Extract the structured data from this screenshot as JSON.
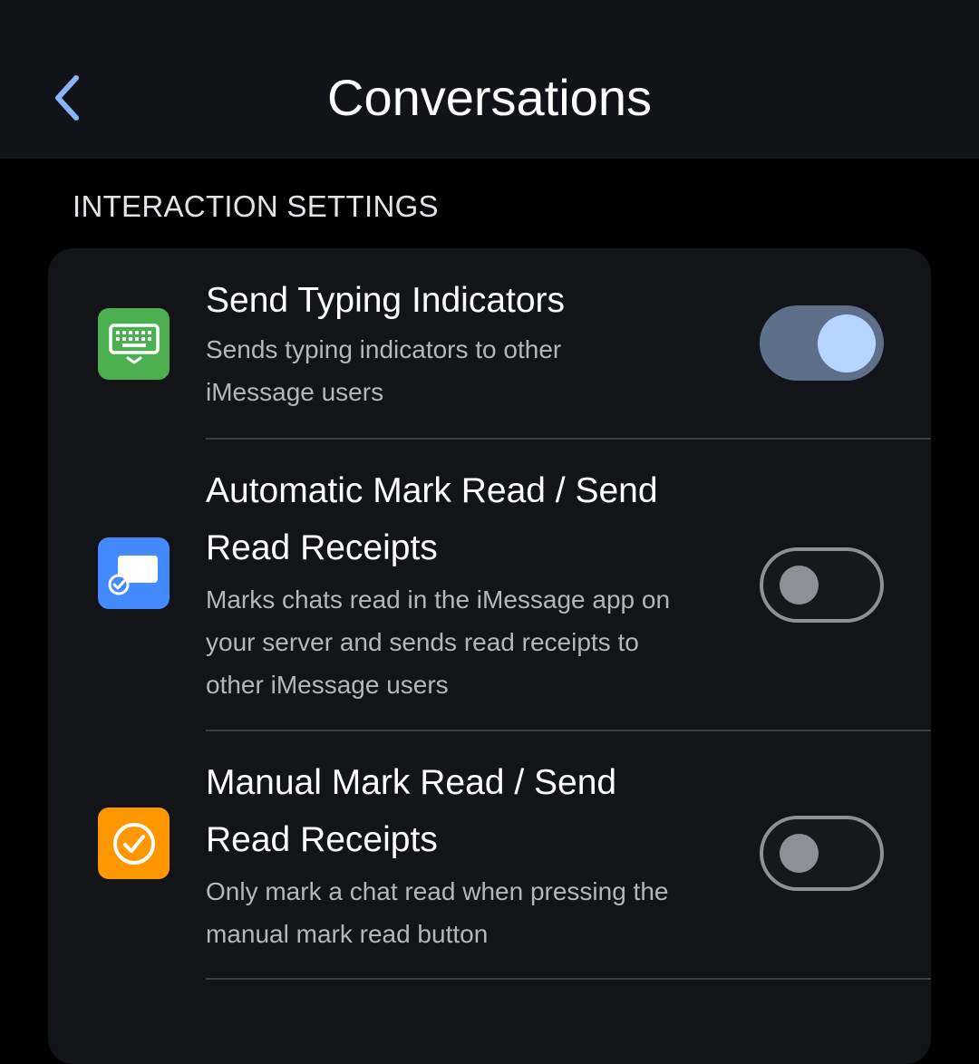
{
  "header": {
    "title": "Conversations",
    "back_icon": "chevron-left-icon",
    "accent_color": "#8ab4f8"
  },
  "section": {
    "title": "INTERACTION SETTINGS"
  },
  "settings": [
    {
      "title_lines": [
        "Send Typing Indicators"
      ],
      "subtitle_lines": [
        "Sends typing indicators to other",
        "iMessage users"
      ],
      "icon": "keyboard-icon",
      "icon_color": "#4caf50",
      "enabled": true
    },
    {
      "title_lines": [
        "Automatic Mark Read / Send",
        "Read Receipts"
      ],
      "subtitle_lines": [
        "Marks chats read in the iMessage app on",
        "your server and sends read receipts to",
        "other iMessage users"
      ],
      "icon": "mark-read-icon",
      "icon_color": "#448aff",
      "enabled": false
    },
    {
      "title_lines": [
        "Manual Mark Read / Send",
        "Read Receipts"
      ],
      "subtitle_lines": [
        "Only mark a chat read when pressing the",
        "manual mark read button"
      ],
      "icon": "check-circle-icon",
      "icon_color": "#ff9800",
      "enabled": false
    }
  ]
}
